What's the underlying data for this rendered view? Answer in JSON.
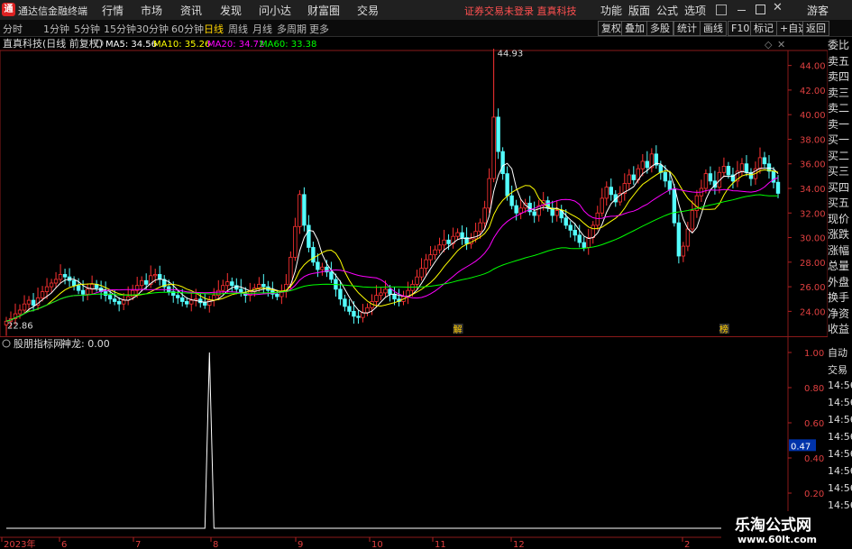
{
  "titlebar": {
    "app_title": "通达信金融终端",
    "menu": [
      "行情",
      "市场",
      "资讯",
      "发现",
      "问小达",
      "财富圈",
      "交易"
    ],
    "status": "证券交易未登录  直真科技",
    "right_menu": [
      "功能",
      "版面",
      "公式",
      "选项"
    ],
    "guest": "游客"
  },
  "periods": [
    "分时",
    "1分钟",
    "5分钟",
    "15分钟",
    "30分钟",
    "60分钟",
    "日线",
    "周线",
    "月线",
    "多周期",
    "更多"
  ],
  "active_period": "日线",
  "right_buttons": [
    "复权",
    "叠加",
    "多股",
    "统计",
    "画线",
    "F10",
    "标记",
    "+自选",
    "返回"
  ],
  "main_chart": {
    "title": "直真科技(日线 前复权)",
    "ma": [
      {
        "label": "MA5: 34.56",
        "color": "#ffffff"
      },
      {
        "label": "MA10: 35.26",
        "color": "#ffff00"
      },
      {
        "label": "MA20: 34.72",
        "color": "#ff00ff"
      },
      {
        "label": "MA60: 33.38",
        "color": "#00ff00"
      }
    ],
    "high_label": "44.93",
    "low_label": "22.86",
    "event_labels": [
      "解",
      "榜"
    ]
  },
  "chart_data": {
    "type": "candlestick",
    "y_ticks": [
      "44.00",
      "42.00",
      "40.00",
      "38.00",
      "36.00",
      "34.00",
      "32.00",
      "30.00",
      "28.00",
      "26.00",
      "24.00"
    ],
    "y_range": [
      23,
      45
    ],
    "x_ticks": [
      "2023年",
      "6",
      "7",
      "8",
      "9",
      "10",
      "11",
      "12",
      "2"
    ],
    "closes": [
      23.2,
      23.4,
      23.8,
      24.1,
      24.6,
      24.9,
      24.5,
      25.1,
      25.6,
      26.0,
      26.3,
      26.6,
      27.0,
      26.8,
      26.5,
      26.1,
      25.7,
      25.4,
      25.8,
      26.2,
      25.9,
      25.6,
      25.3,
      25.0,
      24.8,
      24.6,
      24.9,
      25.2,
      25.7,
      26.1,
      26.5,
      26.2,
      26.9,
      27.0,
      26.6,
      26.0,
      25.6,
      25.3,
      25.1,
      24.8,
      24.6,
      24.9,
      25.0,
      24.7,
      24.5,
      24.9,
      25.3,
      25.7,
      26.1,
      26.4,
      26.1,
      25.8,
      25.5,
      25.3,
      25.6,
      25.9,
      26.2,
      26.0,
      25.7,
      25.4,
      25.2,
      25.6,
      26.2,
      28.4,
      30.9,
      33.5,
      31.0,
      29.2,
      28.0,
      27.4,
      27.6,
      27.2,
      26.6,
      25.8,
      25.0,
      24.4,
      24.0,
      23.6,
      23.5,
      23.9,
      24.3,
      24.8,
      25.3,
      25.5,
      25.8,
      25.4,
      25.0,
      24.8,
      25.2,
      25.7,
      26.2,
      26.8,
      27.5,
      28.2,
      28.6,
      29.0,
      29.4,
      29.8,
      29.5,
      30.1,
      30.4,
      30.0,
      29.5,
      29.9,
      30.5,
      31.2,
      32.4,
      34.8,
      39.8,
      37.0,
      35.2,
      33.4,
      32.6,
      32.0,
      32.4,
      32.8,
      32.1,
      31.8,
      32.6,
      33.0,
      32.4,
      31.8,
      32.2,
      31.6,
      31.0,
      30.6,
      30.2,
      29.6,
      29.2,
      30.0,
      31.0,
      32.0,
      33.2,
      34.1,
      33.5,
      32.9,
      33.6,
      34.4,
      35.1,
      34.7,
      35.6,
      36.2,
      35.7,
      36.8,
      35.9,
      35.3,
      34.6,
      33.9,
      31.2,
      28.5,
      29.3,
      30.7,
      32.2,
      33.4,
      34.0,
      35.2,
      34.6,
      34.1,
      35.3,
      35.8,
      35.1,
      34.6,
      35.4,
      36.0,
      35.3,
      34.8,
      35.6,
      36.5,
      36.0,
      35.4,
      34.5,
      33.6
    ],
    "indicator": {
      "name": "股朋指标网",
      "series_label": "神龙: 0.00",
      "y_ticks": [
        "1.00",
        "0.80",
        "0.60",
        "0.40",
        "0.20"
      ],
      "current_marker": "0.47",
      "spike_index": 45
    }
  },
  "sidebar": [
    "委比",
    "卖五",
    "卖四",
    "卖三",
    "卖二",
    "卖一",
    "买一",
    "买二",
    "买三",
    "买四",
    "买五",
    "现价",
    "涨跌",
    "涨幅",
    "总量",
    "外盘",
    "换手",
    "净资",
    "收益"
  ],
  "sidebar2": [
    "自动",
    "交易",
    "14:56",
    "14:56",
    "14:56",
    "14:56",
    "14:56",
    "14:56",
    "14:56",
    "14:56",
    "14:56",
    "14:56"
  ],
  "watermark": {
    "line1": "乐淘公式网",
    "line2": "www.60lt.com"
  }
}
